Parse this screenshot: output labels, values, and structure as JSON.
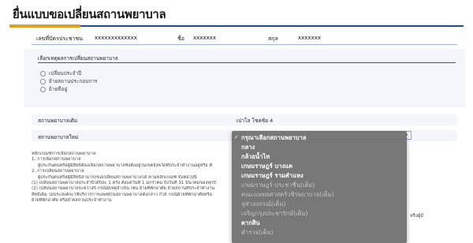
{
  "page": {
    "title": "ยื่นแบบขอเปลี่ยนสถานพยาบาล"
  },
  "person": {
    "id_label": "เลขที่บัตรประชาชน",
    "id_value": "xxxxxxxxxxxxx",
    "name_label": "ชื่อ",
    "name_value": "xxxxxxx",
    "surname_label": "สกุล",
    "surname_value": "xxxxxxx"
  },
  "reason": {
    "label": "เลือกเหตุผลการเปลี่ยนสถานพยาบาล",
    "options": [
      "เปลี่ยนประจำปี",
      "ย้ายสถานประกอบการ",
      "ย้ายที่อยู่"
    ]
  },
  "hospital": {
    "old_label": "สถานพยาบาลเดิม",
    "old_value": "เปาโล โชคชัย 4",
    "new_label": "สถานพยาบาลใหม่"
  },
  "dropdown": {
    "options": [
      {
        "label": "กรุณาเลือกสถานพยาบาล",
        "selected": true,
        "enabled": true
      },
      {
        "label": "กลาง",
        "selected": false,
        "enabled": true
      },
      {
        "label": "กล้วยน้ำไท",
        "selected": false,
        "enabled": true
      },
      {
        "label": "เกษมราษฎร์ บางแค",
        "selected": false,
        "enabled": true
      },
      {
        "label": "เกษมราษฎร์ รามคำแหง",
        "selected": false,
        "enabled": true
      },
      {
        "label": "เกษมราษฎร์ ประชาชื่น(เต็ม)",
        "selected": false,
        "enabled": false
      },
      {
        "label": "คณะแพทยศาสตร์วชิรพยาบาล(เต็ม)",
        "selected": false,
        "enabled": false
      },
      {
        "label": "จุฬาลงกรณ์(เต็ม)",
        "selected": false,
        "enabled": false
      },
      {
        "label": "เจริญกรุงประชารักษ์(เต็ม)",
        "selected": false,
        "enabled": false
      },
      {
        "label": "ตากสิน",
        "selected": false,
        "enabled": true
      },
      {
        "label": "ตำรวจ(เต็ม)",
        "selected": false,
        "enabled": false
      }
    ]
  },
  "criteria": {
    "lines": [
      "หลักเกณฑ์การเลือกสถานพยาบาล",
      "1. การเลือกสถานพยาบาล",
      "ผู้ประกันตนหรือผู้มีสิทธิต้องเลือกสถานพยาบาลซึ่งตั้งอยู่ในเขตจังหวัดที่ประจำทำงานอยู่หรือ ทั",
      "2. การเปลี่ยนสถานพยาบาล",
      "ผู้ประกันตนหรือผู้มีสิทธิสามารถขอเปลี่ยนสถานพยาบาลได้ ตามหลักเกณฑ์ ดังต่อไปนี้",
      "(1) เปลี่ยนสถานพยาบาลประจำปีได้ปีละ 1 ครั้ง ตั้งแต่วันที่ 1 มกราคม ถึงวันที่ 31 มีนาคมของทุกปี",
      "(2) เปลี่ยนสถานพยาบาลระหว่างปี กรณีมีเหตุจำเป็น เช่น ย้ายที่พักอาศัย ย้ายสถานที่ประจำทำงาน",
      "สิทธิเดิม ไม่ประสงค์จะใช้บริการการแพทย์ในสถานพยาบาลดังกล่าว ก็ได้ กรณีย้ายที่พักอาศัยหรือ",
      "ย้ายที่พักอาศัย หรือย้ายสถานประจำทำงาน"
    ],
    "right_tail": "หรือผู้มี"
  }
}
